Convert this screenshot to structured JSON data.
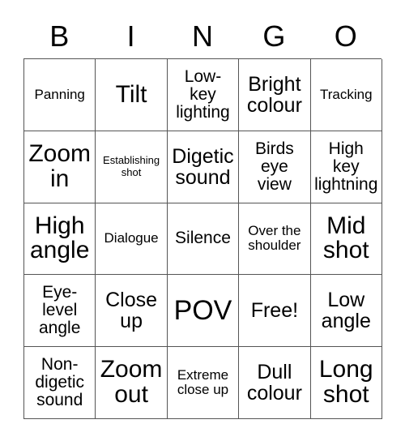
{
  "card": {
    "title": "BINGO",
    "header_letters": [
      "B",
      "I",
      "N",
      "G",
      "O"
    ],
    "columns": 5,
    "rows": 5,
    "colors": {
      "background": "#ffffff",
      "cell_background": "#ffffff",
      "border": "#555555",
      "text": "#000000"
    },
    "cells": [
      {
        "label": "Panning",
        "size": "fs-m"
      },
      {
        "label": "Tilt",
        "size": "fs-xxl"
      },
      {
        "label": "Low-\nkey\nlighting",
        "size": "fs-l"
      },
      {
        "label": "Bright\ncolour",
        "size": "fs-xl"
      },
      {
        "label": "Tracking",
        "size": "fs-m"
      },
      {
        "label": "Zoom\nin",
        "size": "fs-xxl"
      },
      {
        "label": "Establishing\nshot",
        "size": "fs-xs"
      },
      {
        "label": "Digetic\nsound",
        "size": "fs-xl"
      },
      {
        "label": "Birds\neye\nview",
        "size": "fs-l"
      },
      {
        "label": "High\nkey\nlightning",
        "size": "fs-l"
      },
      {
        "label": "High\nangle",
        "size": "fs-xxl"
      },
      {
        "label": "Dialogue",
        "size": "fs-m"
      },
      {
        "label": "Silence",
        "size": "fs-l"
      },
      {
        "label": "Over the\nshoulder",
        "size": "fs-m"
      },
      {
        "label": "Mid\nshot",
        "size": "fs-xxl"
      },
      {
        "label": "Eye-\nlevel\nangle",
        "size": "fs-l"
      },
      {
        "label": "Close\nup",
        "size": "fs-xl"
      },
      {
        "label": "POV",
        "size": "fs-max"
      },
      {
        "label": "Free!",
        "size": "fs-xl"
      },
      {
        "label": "Low\nangle",
        "size": "fs-xl"
      },
      {
        "label": "Non-\ndigetic\nsound",
        "size": "fs-l"
      },
      {
        "label": "Zoom\nout",
        "size": "fs-xxl"
      },
      {
        "label": "Extreme\nclose up",
        "size": "fs-m"
      },
      {
        "label": "Dull\ncolour",
        "size": "fs-xl"
      },
      {
        "label": "Long\nshot",
        "size": "fs-xxl"
      }
    ]
  }
}
